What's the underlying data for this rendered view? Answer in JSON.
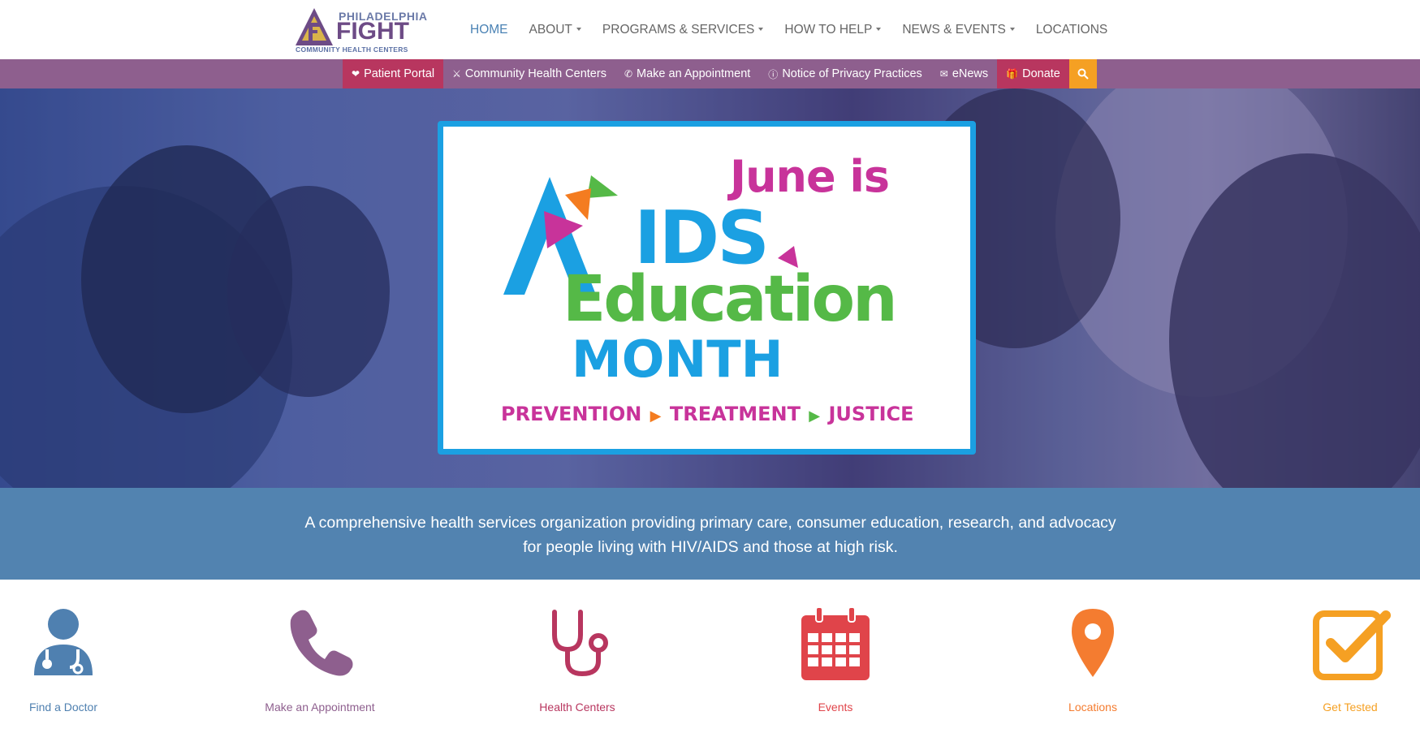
{
  "brand": {
    "line1": "PHILADELPHIA",
    "line2": "FIGHT",
    "line3": "COMMUNITY HEALTH CENTERS",
    "colors": {
      "purple": "#6d4b86",
      "gold": "#d9b44a",
      "blue": "#5b70a5"
    }
  },
  "main_nav": [
    {
      "label": "HOME",
      "dropdown": false,
      "active": true
    },
    {
      "label": "ABOUT",
      "dropdown": true,
      "active": false
    },
    {
      "label": "PROGRAMS & SERVICES",
      "dropdown": true,
      "active": false
    },
    {
      "label": "HOW TO HELP",
      "dropdown": true,
      "active": false
    },
    {
      "label": "NEWS & EVENTS",
      "dropdown": true,
      "active": false
    },
    {
      "label": "LOCATIONS",
      "dropdown": false,
      "active": false
    }
  ],
  "util_nav": [
    {
      "label": "Patient Portal",
      "icon": "heartbeat-icon"
    },
    {
      "label": "Community Health Centers",
      "icon": "stethoscope-icon"
    },
    {
      "label": "Make an Appointment",
      "icon": "phone-icon"
    },
    {
      "label": "Notice of Privacy Practices",
      "icon": "info-icon"
    },
    {
      "label": "eNews",
      "icon": "envelope-icon"
    },
    {
      "label": "Donate",
      "icon": "gift-icon"
    }
  ],
  "util_colors": {
    "bar": "#8e5f8e",
    "highlight": "#b8365f",
    "search": "#f5a023"
  },
  "hero": {
    "line1": "June is",
    "line2": "IDS",
    "line3": "Education",
    "line4": "MONTH",
    "tagline_1": "PREVENTION",
    "tagline_2": "TREATMENT",
    "tagline_3": "JUSTICE"
  },
  "mission": {
    "text": "A comprehensive health services organization providing primary care, consumer education, research, and advocacy for people living with HIV/AIDS and those at high risk."
  },
  "quick_links": [
    {
      "label": "Find a Doctor",
      "icon": "doctor-icon",
      "color": "#4f80b0"
    },
    {
      "label": "Make an Appointment",
      "icon": "phone-icon",
      "color": "#8e5f8e"
    },
    {
      "label": "Health Centers",
      "icon": "stethoscope-icon",
      "color": "#b8365f"
    },
    {
      "label": "Events",
      "icon": "calendar-icon",
      "color": "#e0444a"
    },
    {
      "label": "Locations",
      "icon": "map-marker-icon",
      "color": "#f47c30"
    },
    {
      "label": "Get Tested",
      "icon": "checkbox-icon",
      "color": "#f5a023"
    }
  ]
}
